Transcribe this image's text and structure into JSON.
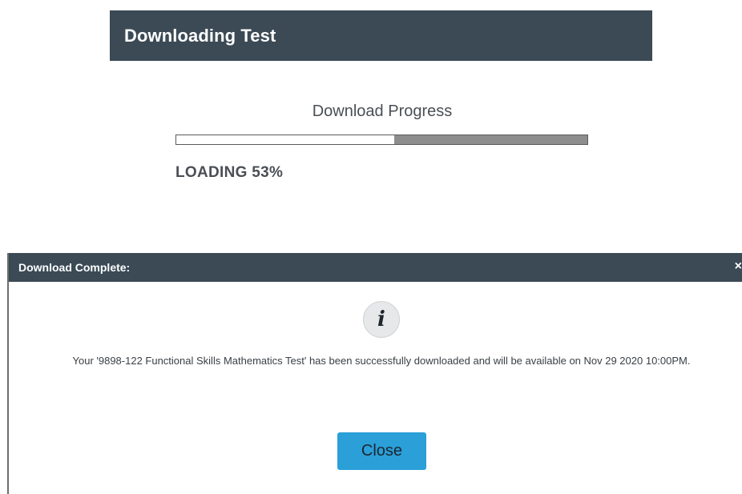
{
  "download_panel": {
    "title": "Downloading Test",
    "progress_label": "Download Progress",
    "progress_percent": 53,
    "status_text": "LOADING 53%"
  },
  "complete_dialog": {
    "title": "Download Complete:",
    "close_x": "×",
    "icon": "info-icon",
    "icon_glyph": "i",
    "message": "Your '9898-122 Functional Skills Mathematics Test' has been successfully downloaded and will be available on Nov 29 2020 10:00PM.",
    "close_button_label": "Close"
  },
  "colors": {
    "header_bg": "#3b4a55",
    "button_bg": "#2a9fd8",
    "progress_remaining": "#8d8d8d"
  }
}
